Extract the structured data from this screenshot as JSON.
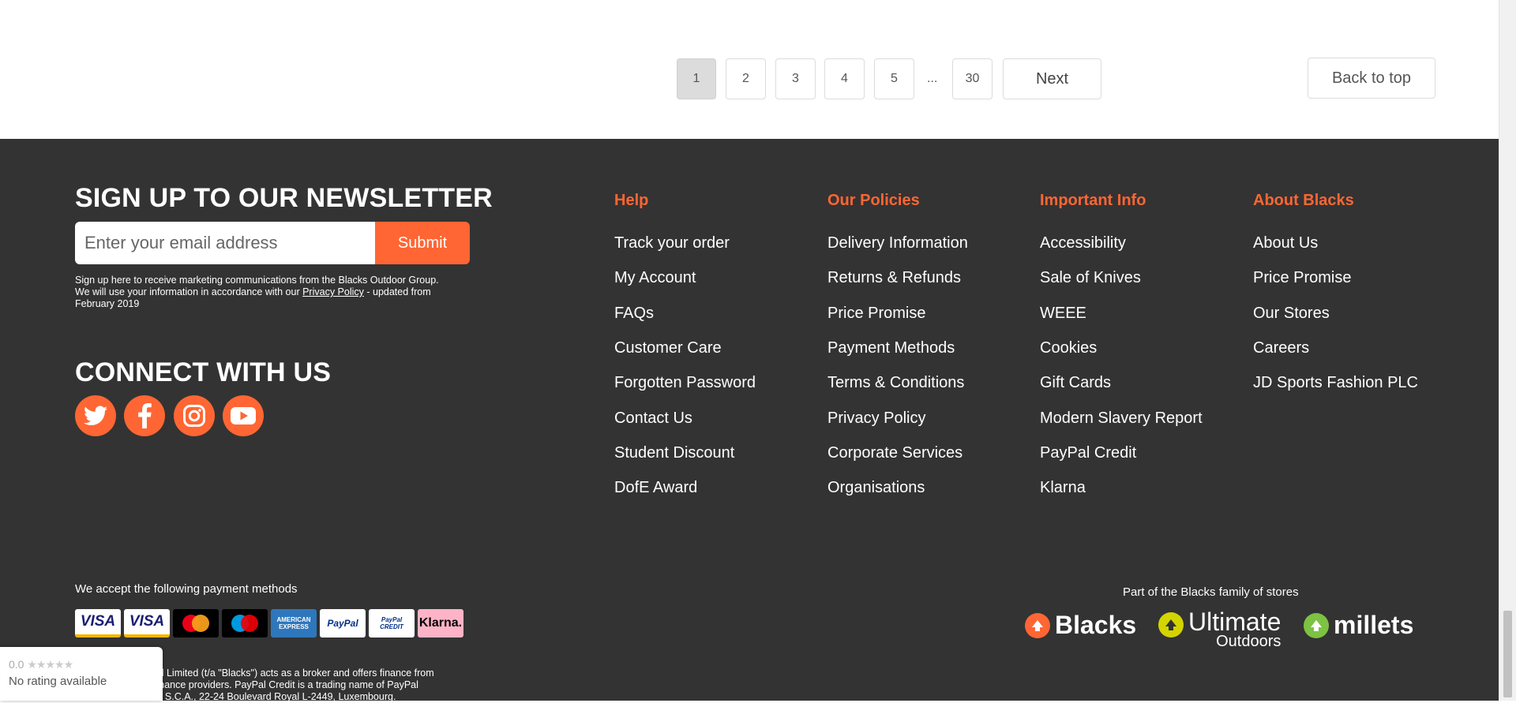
{
  "pagination": {
    "pages": [
      "1",
      "2",
      "3",
      "4",
      "5"
    ],
    "ellipsis": "...",
    "last_page": "30",
    "next_label": "Next",
    "active_page": "1"
  },
  "back_to_top": "Back to top",
  "newsletter": {
    "heading": "SIGN UP TO OUR NEWSLETTER",
    "placeholder": "Enter your email address",
    "submit_label": "Submit",
    "note_part1": "Sign up here to receive marketing communications from the Blacks Outdoor Group. We will use your information in accordance with our ",
    "note_link": "Privacy Policy",
    "note_part2": " - updated from February 2019"
  },
  "connect": {
    "heading": "CONNECT WITH US",
    "icons": [
      "twitter-icon",
      "facebook-icon",
      "instagram-icon",
      "youtube-icon"
    ]
  },
  "columns": [
    {
      "heading": "Help",
      "links": [
        "Track your order",
        "My Account",
        "FAQs",
        "Customer Care",
        "Forgotten Password",
        "Contact Us",
        "Student Discount",
        "DofE Award"
      ]
    },
    {
      "heading": "Our Policies",
      "links": [
        "Delivery Information",
        "Returns & Refunds",
        "Price Promise",
        "Payment Methods",
        "Terms & Conditions",
        "Privacy Policy",
        "Corporate Services",
        "Organisations"
      ]
    },
    {
      "heading": "Important Info",
      "links": [
        "Accessibility",
        "Sale of Knives",
        "WEEE",
        "Cookies",
        "Gift Cards",
        "Modern Slavery Report",
        "PayPal Credit",
        "Klarna"
      ]
    },
    {
      "heading": "About Blacks",
      "links": [
        "About Us",
        "Price Promise",
        "Our Stores",
        "Careers",
        "JD Sports Fashion PLC"
      ]
    }
  ],
  "payments": {
    "label": "We accept the following payment methods",
    "cards": [
      "VISA",
      "VISA",
      "mastercard",
      "maestro",
      "AMERICAN EXPRESS",
      "PayPal",
      "PayPal CREDIT",
      "Klarna."
    ]
  },
  "family": {
    "label": "Part of the Blacks family of stores",
    "brands": [
      "Blacks",
      "Ultimate",
      "Outdoors",
      "millets"
    ]
  },
  "legal": {
    "line1": "ail Limited (t/a \"Blacks\") acts as a broker and offers finance from",
    "line2": "finance providers. PayPal Credit is a trading name of PayPal",
    "line3": "e, S.C.A., 22-24 Boulevard Royal L-2449, Luxembourg."
  },
  "rating": {
    "score": "0.0",
    "stars": "★★★★★",
    "text": "No rating available"
  },
  "colors": {
    "accent": "#ff6633",
    "footer_bg": "#333333",
    "klarna_pink": "#ffb3c7"
  }
}
